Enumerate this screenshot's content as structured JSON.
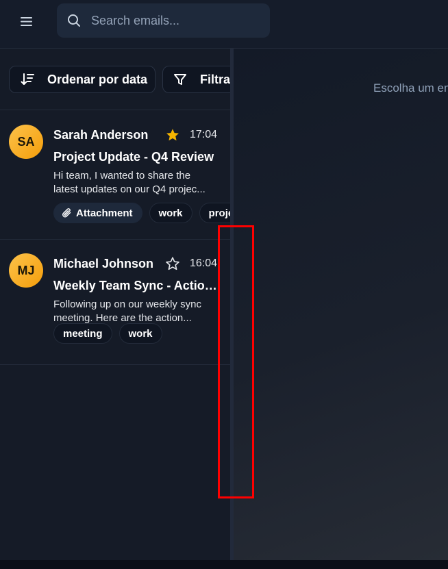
{
  "header": {
    "menu_icon": "hamburger-menu-icon",
    "search": {
      "placeholder": "Search emails...",
      "value": "",
      "icon": "search-icon"
    }
  },
  "toolbar": {
    "sort_label": "Ordenar por data",
    "sort_icon": "sort-descending-icon",
    "filter_label": "Filtrar",
    "filter_icon": "filter-funnel-icon"
  },
  "emails": [
    {
      "initials": "SA",
      "sender": "Sarah Anderson",
      "starred": true,
      "time": "17:04",
      "subject": "Project Update - Q4 Review",
      "preview_line1": "Hi team, I wanted to share the",
      "preview_line2": "latest updates on our Q4 projec...",
      "tags": [
        "Attachment",
        "work",
        "project"
      ],
      "has_attachment": true
    },
    {
      "initials": "MJ",
      "sender": "Michael Johnson",
      "starred": false,
      "time": "16:04",
      "subject": "Weekly Team Sync - Action Items",
      "preview_line1": "Following up on our weekly sync",
      "preview_line2": "meeting. Here are the action...",
      "tags": [
        "meeting",
        "work"
      ],
      "has_attachment": false
    }
  ],
  "detail": {
    "empty_message": "Escolha um email"
  },
  "colors": {
    "background": "#141b28",
    "avatar_accent": "#f59e0b",
    "star_filled": "#f5b400",
    "highlight_outline": "#ff0000"
  }
}
